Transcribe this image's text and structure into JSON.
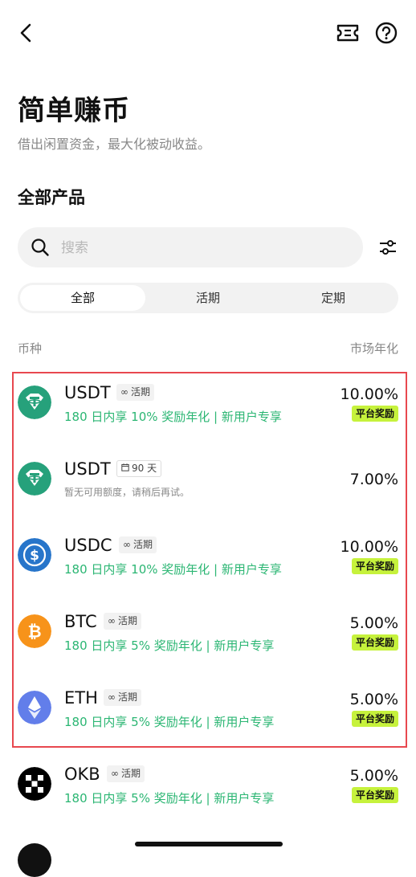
{
  "header": {
    "back_icon": "chevron-left-icon",
    "ticket_icon": "ticket-icon",
    "help_icon": "help-circle-icon"
  },
  "page": {
    "title": "简单赚币",
    "subtitle": "借出闲置资金，最大化被动收益。",
    "section_title": "全部产品"
  },
  "search": {
    "placeholder": "搜索",
    "value": ""
  },
  "tabs": [
    {
      "label": "全部",
      "active": true
    },
    {
      "label": "活期",
      "active": false
    },
    {
      "label": "定期",
      "active": false
    }
  ],
  "columns": {
    "left": "币种",
    "right": "市场年化"
  },
  "colors": {
    "accent_green": "#2bb673",
    "badge_lime": "#c6f23c",
    "highlight_red": "#e8484f",
    "usdt": "#26a17b",
    "usdc": "#2775ca",
    "btc": "#f7931a",
    "eth": "#627eea",
    "okb": "#000000"
  },
  "products": [
    {
      "coin": "USDT",
      "icon": "usdt-icon",
      "tag_icon": "infinity-icon",
      "tag": "活期",
      "promo": "180 日内享 10% 奖励年化 | 新用户专享",
      "rate": "10.00%",
      "badge": "平台奖励"
    },
    {
      "coin": "USDT",
      "icon": "usdt-icon",
      "tag_icon": "calendar-icon",
      "tag": "90 天",
      "promo": "暂无可用额度，请稍后再试。",
      "rate": "7.00%",
      "badge": ""
    },
    {
      "coin": "USDC",
      "icon": "usdc-icon",
      "tag_icon": "infinity-icon",
      "tag": "活期",
      "promo": "180 日内享 10% 奖励年化 | 新用户专享",
      "rate": "10.00%",
      "badge": "平台奖励"
    },
    {
      "coin": "BTC",
      "icon": "btc-icon",
      "tag_icon": "infinity-icon",
      "tag": "活期",
      "promo": "180 日内享 5% 奖励年化 | 新用户专享",
      "rate": "5.00%",
      "badge": "平台奖励"
    },
    {
      "coin": "ETH",
      "icon": "eth-icon",
      "tag_icon": "infinity-icon",
      "tag": "活期",
      "promo": "180 日内享 5% 奖励年化 | 新用户专享",
      "rate": "5.00%",
      "badge": "平台奖励"
    },
    {
      "coin": "OKB",
      "icon": "okb-icon",
      "tag_icon": "infinity-icon",
      "tag": "活期",
      "promo": "180 日内享 5% 奖励年化 | 新用户专享",
      "rate": "5.00%",
      "badge": "平台奖励"
    }
  ]
}
